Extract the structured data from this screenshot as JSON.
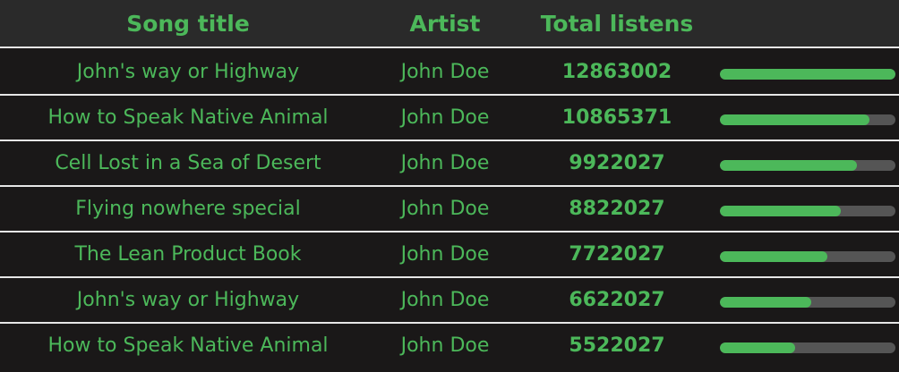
{
  "header": {
    "song_title": "Song title",
    "artist": "Artist",
    "total_listens": "Total listens"
  },
  "rows": [
    {
      "title": "John's way or Highway",
      "artist": "John Doe",
      "listens": "12863002",
      "progress": 1.0
    },
    {
      "title": "How to Speak Native Animal",
      "artist": "John Doe",
      "listens": "10865371",
      "progress": 0.85
    },
    {
      "title": "Cell Lost in a Sea of Desert",
      "artist": "John Doe",
      "listens": "9922027",
      "progress": 0.78
    },
    {
      "title": "Flying nowhere special",
      "artist": "John Doe",
      "listens": "8822027",
      "progress": 0.69
    },
    {
      "title": "The Lean Product Book",
      "artist": "John Doe",
      "listens": "7722027",
      "progress": 0.61
    },
    {
      "title": "John's way or Highway",
      "artist": "John Doe",
      "listens": "6622027",
      "progress": 0.52
    },
    {
      "title": "How to Speak Native Animal",
      "artist": "John Doe",
      "listens": "5522027",
      "progress": 0.43
    }
  ],
  "colors": {
    "accent": "#4cb85a",
    "track": "#555555",
    "background": "#1a1818",
    "header_background": "#2a2a2a",
    "divider": "#e6e6e6"
  }
}
